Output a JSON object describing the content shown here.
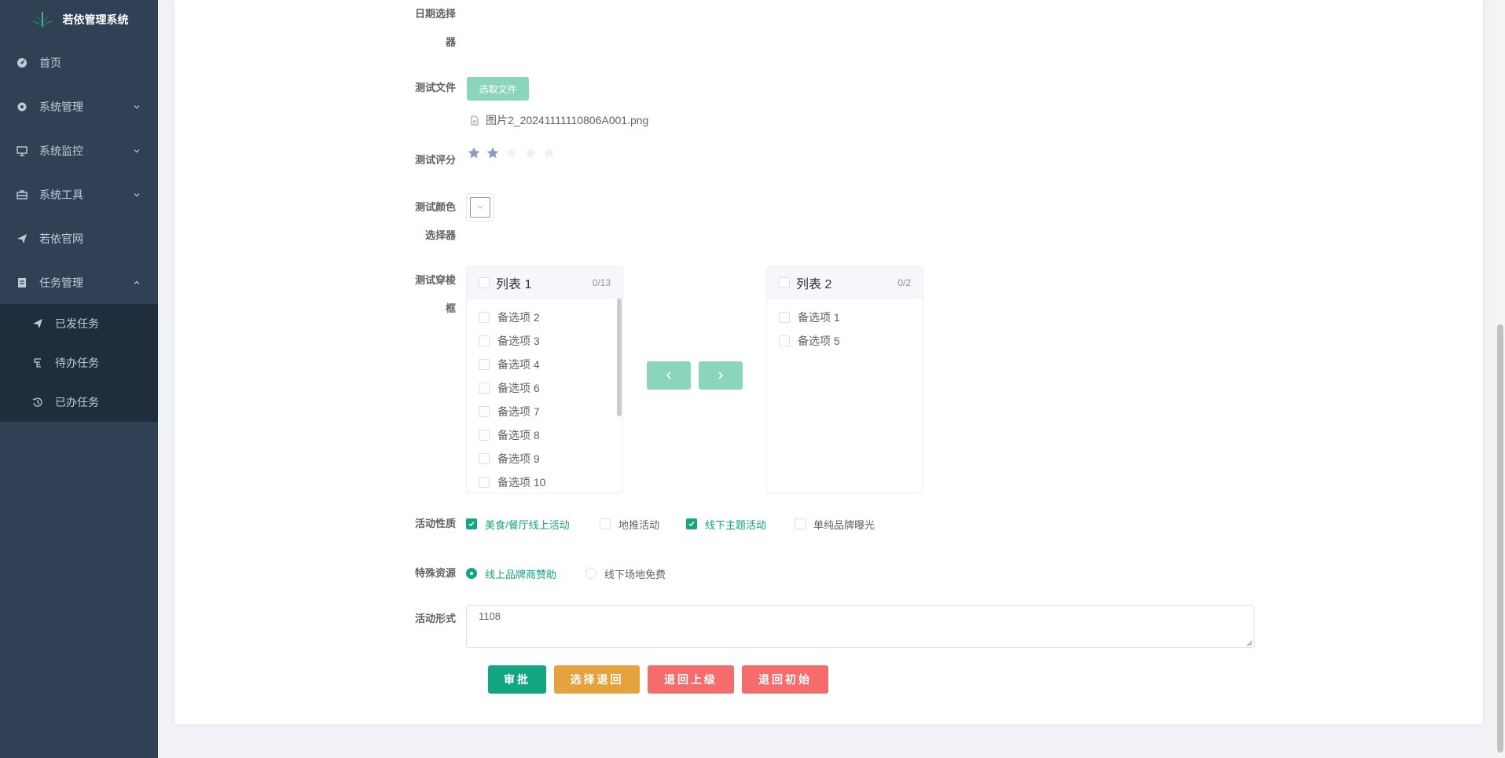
{
  "app": {
    "title": "若依管理系统"
  },
  "sidebar": {
    "items": [
      {
        "label": "首页",
        "icon": "dashboard-icon"
      },
      {
        "label": "系统管理",
        "icon": "gear-icon"
      },
      {
        "label": "系统监控",
        "icon": "monitor-icon"
      },
      {
        "label": "系统工具",
        "icon": "toolbox-icon"
      },
      {
        "label": "若依官网",
        "icon": "paper-plane-icon"
      },
      {
        "label": "任务管理",
        "icon": "clipboard-icon"
      }
    ],
    "sub_items": [
      {
        "label": "已发任务",
        "icon": "paper-plane-icon"
      },
      {
        "label": "待办任务",
        "icon": "todo-icon"
      },
      {
        "label": "已办任务",
        "icon": "history-icon"
      }
    ]
  },
  "form": {
    "date_picker": {
      "label_line1": "日期选择",
      "label_line2": "器"
    },
    "file": {
      "label": "测试文件",
      "button": "选取文件",
      "file_name": "图片2_20241111110806A001.png"
    },
    "rating": {
      "label": "测试评分",
      "value": 2,
      "max": 5
    },
    "color": {
      "label_line1": "测试颜色",
      "label_line2": "选择器"
    },
    "transfer": {
      "label_line1": "测试穿梭",
      "label_line2": "框",
      "left": {
        "title": "列表 1",
        "count": "0/13",
        "items": [
          "备选项 2",
          "备选项 3",
          "备选项 4",
          "备选项 6",
          "备选项 7",
          "备选项 8",
          "备选项 9",
          "备选项 10"
        ]
      },
      "right": {
        "title": "列表 2",
        "count": "0/2",
        "items": [
          "备选项 1",
          "备选项 5"
        ]
      }
    },
    "activity_nature": {
      "label": "活动性质",
      "options": [
        {
          "label": "美食/餐厅线上活动",
          "checked": true
        },
        {
          "label": "地推活动",
          "checked": false
        },
        {
          "label": "线下主题活动",
          "checked": true
        },
        {
          "label": "单纯品牌曝光",
          "checked": false
        }
      ]
    },
    "special_resource": {
      "label": "特殊资源",
      "options": [
        {
          "label": "线上品牌商赞助",
          "checked": true
        },
        {
          "label": "线下场地免费",
          "checked": false
        }
      ]
    },
    "activity_form": {
      "label": "活动形式",
      "value": "1108"
    }
  },
  "actions": {
    "approve": "审批",
    "select_return": "选择退回",
    "return_previous": "退回上级",
    "return_initial": "退回初始"
  },
  "colors": {
    "primary": "#13a683",
    "primary_light": "#8bd5be",
    "warning": "#e6a23c",
    "danger": "#f56c6c",
    "sidebar_bg": "#304156",
    "submenu_bg": "#1f2d3d",
    "star_on": "#8b9bbf",
    "star_off": "#eef0f4"
  }
}
